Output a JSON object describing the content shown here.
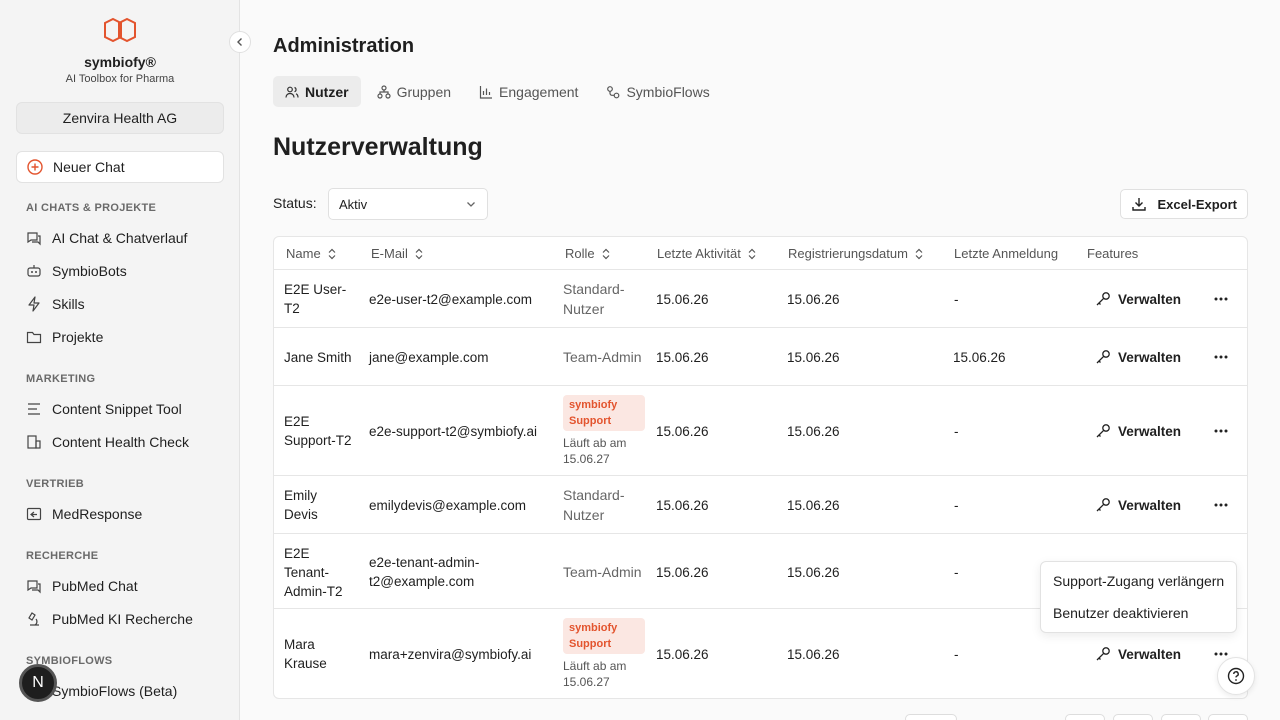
{
  "colors": {
    "accent": "#e3542e",
    "sidebar_bg": "#f4f4f4",
    "badge_bg": "#fbe7e2"
  },
  "sidebar": {
    "brand": "symbiofy®",
    "tagline": "AI Toolbox for Pharma",
    "org": "Zenvira Health AG",
    "new_chat": "Neuer Chat",
    "sections": {
      "ai": "AI CHATS & PROJEKTE",
      "marketing": "MARKETING",
      "vertrieb": "VERTRIEB",
      "recherche": "RECHERCHE",
      "flows": "SYMBIOFLOWS"
    },
    "items": {
      "chat": "AI Chat & Chatverlauf",
      "bots": "SymbioBots",
      "skills": "Skills",
      "projekte": "Projekte",
      "snippet": "Content Snippet Tool",
      "health": "Content Health Check",
      "medresponse": "MedResponse",
      "pubmed_chat": "PubMed Chat",
      "pubmed_ki": "PubMed KI Recherche",
      "flows_beta": "SymbioFlows (Beta)"
    },
    "avatar_letter": "N"
  },
  "main": {
    "title": "Administration",
    "tabs": [
      "Nutzer",
      "Gruppen",
      "Engagement",
      "SymbioFlows"
    ],
    "section_title": "Nutzerverwaltung",
    "status_label": "Status:",
    "status_value": "Aktiv",
    "export_label": "Excel-Export"
  },
  "table": {
    "headers": {
      "name": "Name",
      "email": "E-Mail",
      "role": "Rolle",
      "activity": "Letzte Aktivität",
      "registered": "Registrierungsdatum",
      "login": "Letzte Anmeldung",
      "features": "Features"
    },
    "manage_label": "Verwalten",
    "badge": "symbiofy Support",
    "rows": [
      {
        "name": "E2E User-T2",
        "email": "e2e-user-t2@example.com",
        "role": "Standard-Nutzer",
        "activity": "15.06.26",
        "registered": "15.06.26",
        "login": "-"
      },
      {
        "name": "Jane Smith",
        "email": "jane@example.com",
        "role": "Team-Admin",
        "activity": "15.06.26",
        "registered": "15.06.26",
        "login": "15.06.26"
      },
      {
        "name": "E2E Support-T2",
        "email": "e2e-support-t2@symbiofy.ai",
        "role_badge": "symbiofy Support",
        "expiry": "Läuft ab am 15.06.27",
        "activity": "15.06.26",
        "registered": "15.06.26",
        "login": "-"
      },
      {
        "name": "Emily Devis",
        "email": "emilydevis@example.com",
        "role": "Standard-Nutzer",
        "activity": "15.06.26",
        "registered": "15.06.26",
        "login": "-"
      },
      {
        "name": "E2E Tenant-Admin-T2",
        "email": "e2e-tenant-admin-t2@example.com",
        "role": "Team-Admin",
        "activity": "15.06.26",
        "registered": "15.06.26",
        "login": "-"
      },
      {
        "name": "Mara Krause",
        "email": "mara+zenvira@symbiofy.ai",
        "role_badge": "symbiofy Support",
        "expiry": "Läuft ab am 15.06.27",
        "activity": "15.06.26",
        "registered": "15.06.26",
        "login": "-"
      }
    ]
  },
  "context_menu": {
    "items": [
      "Support-Zugang verlängern",
      "Benutzer deaktivieren"
    ]
  }
}
